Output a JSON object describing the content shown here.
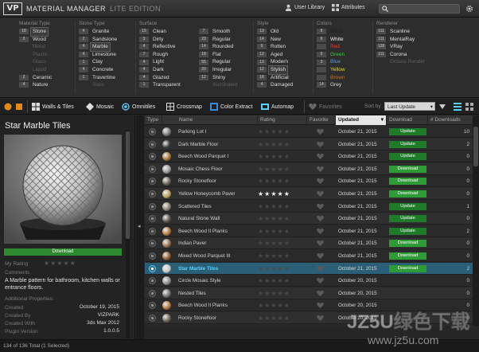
{
  "title_bar": {
    "logo": "VP",
    "app_title": "MATERIAL MANAGER",
    "edition": "LITE EDITION",
    "user_library": "User Library",
    "attributes": "Attributes",
    "search_placeholder": ""
  },
  "filters": {
    "material_type": {
      "header": "Material Type",
      "items": [
        {
          "count": "18",
          "label": "Stone",
          "selected": true
        },
        {
          "count": "3",
          "label": "Wood",
          "selected": false
        },
        {
          "count": "",
          "label": "Metal",
          "dim": true
        },
        {
          "count": "",
          "label": "Plastic",
          "dim": true
        },
        {
          "count": "",
          "label": "Glass",
          "dim": true
        },
        {
          "count": "",
          "label": "Liquid",
          "dim": true
        },
        {
          "count": "2",
          "label": "Ceramic",
          "selected": false
        },
        {
          "count": "4",
          "label": "Nature",
          "selected": false
        }
      ]
    },
    "stone_type": {
      "header": "Stone Type",
      "items": [
        {
          "count": "4",
          "label": "Granite",
          "selected": false
        },
        {
          "count": "2",
          "label": "Sandstone",
          "selected": false
        },
        {
          "count": "4",
          "label": "Marble",
          "selected": true
        },
        {
          "count": "4",
          "label": "Limestone",
          "selected": false
        },
        {
          "count": "1",
          "label": "Clay",
          "selected": false
        },
        {
          "count": "4",
          "label": "Concrete",
          "selected": false
        },
        {
          "count": "1",
          "label": "Travertine",
          "selected": false
        },
        {
          "count": "",
          "label": "Slate",
          "dim": true
        }
      ]
    },
    "surface_1": {
      "header": "Surface",
      "items": [
        {
          "count": "15",
          "label": "Clean",
          "selected": false
        },
        {
          "count": "3",
          "label": "Dirty",
          "selected": false
        },
        {
          "count": "4",
          "label": "Reflective",
          "selected": false
        },
        {
          "count": "7",
          "label": "Rough",
          "selected": false
        },
        {
          "count": "4",
          "label": "Light",
          "selected": false
        },
        {
          "count": "4",
          "label": "Dark",
          "selected": false
        },
        {
          "count": "4",
          "label": "Glazed",
          "selected": false
        },
        {
          "count": "1",
          "label": "Transparent",
          "selected": false
        }
      ]
    },
    "surface_2": {
      "items": [
        {
          "count": "7",
          "label": "Smooth",
          "selected": false
        },
        {
          "count": "23",
          "label": "Regular",
          "selected": false
        },
        {
          "count": "14",
          "label": "Rounded",
          "selected": false
        },
        {
          "count": "18",
          "label": "Flat",
          "selected": false
        },
        {
          "count": "55",
          "label": "Regular",
          "selected": false
        },
        {
          "count": "20",
          "label": "Irregular",
          "selected": false
        },
        {
          "count": "12",
          "label": "Shiny",
          "selected": false
        },
        {
          "count": "",
          "label": "Illuminated",
          "dim": true
        }
      ]
    },
    "style": {
      "header": "Style",
      "items": [
        {
          "count": "13",
          "label": "Old",
          "selected": false
        },
        {
          "count": "14",
          "label": "New",
          "selected": false
        },
        {
          "count": "9",
          "label": "Rotten",
          "selected": false
        },
        {
          "count": "12",
          "label": "Aged",
          "selected": false
        },
        {
          "count": "13",
          "label": "Modern",
          "selected": false
        },
        {
          "count": "12",
          "label": "Stylish",
          "selected": true
        },
        {
          "count": "18",
          "label": "Artificial",
          "selected": false
        },
        {
          "count": "4",
          "label": "Damaged",
          "selected": false
        }
      ]
    },
    "colors": {
      "header": "Colors",
      "items": [
        {
          "count": "8",
          "label": "Black",
          "color": "#222222"
        },
        {
          "count": "6",
          "label": "White",
          "color": "#f0f0f0"
        },
        {
          "count": "",
          "label": "Red",
          "color": "#e03a2a"
        },
        {
          "count": "6",
          "label": "Green",
          "color": "#3cc44a"
        },
        {
          "count": "3",
          "label": "Blue",
          "color": "#4aa0e8"
        },
        {
          "count": "",
          "label": "Yellow",
          "color": "#e8d23a"
        },
        {
          "count": "",
          "label": "Brown",
          "color": "#b87430"
        },
        {
          "count": "14",
          "label": "Grey",
          "color": "#dddddd"
        }
      ]
    },
    "renderer": {
      "header": "Renderer",
      "items": [
        {
          "count": "111",
          "label": "Scanline",
          "selected": false
        },
        {
          "count": "111",
          "label": "MentalRay",
          "selected": false
        },
        {
          "count": "128",
          "label": "VRay",
          "selected": false
        },
        {
          "count": "111",
          "label": "Corona",
          "selected": false
        },
        {
          "count": "",
          "label": "Octane Render",
          "dim": true
        }
      ]
    }
  },
  "toolbar": {
    "walls_tiles": "Walls & Tiles",
    "mosaic": "Mosaic",
    "omnitiles": "Omnitiles",
    "crossmap": "Crossmap",
    "color_extract": "Color Extract",
    "automap": "Automap",
    "favorites": "Favorites",
    "sort_by_label": "Sort by",
    "sort_by_value": "Last Update"
  },
  "preview": {
    "title": "Star Marble Tiles",
    "download_label": "Download",
    "my_rating_label": "My Rating",
    "comments_label": "Comments",
    "description": "A Marble pattern for bathroom, kitchen walls or entrance floors.",
    "additional_properties_label": "Additional Properties:",
    "created_label": "Created",
    "created_value": "October 19, 2015",
    "created_by_label": "Created By",
    "created_by_value": "VIZPARK",
    "created_with_label": "Created With",
    "created_with_value": "3ds Max 2012",
    "plugin_version_label": "Plugin Version",
    "plugin_version_value": "1.0.0.5"
  },
  "list": {
    "columns": {
      "type": "Type",
      "name": "Name",
      "rating": "Rating",
      "favorite": "Favorite",
      "updated": "Updated",
      "download": "Download",
      "downloads": "# Downloads"
    },
    "rows": [
      {
        "name": "Parking Lot I",
        "rating": 0,
        "updated": "October 21, 2015",
        "action": "Update",
        "downloads": "10",
        "thumb": "#7a7a7a"
      },
      {
        "name": "Dark Marble Floor",
        "rating": 0,
        "updated": "October 21, 2015",
        "action": "Update",
        "downloads": "2",
        "thumb": "#3a3a3a"
      },
      {
        "name": "Beech Wood Parquet I",
        "rating": 0,
        "updated": "October 21, 2015",
        "action": "Update",
        "downloads": "0",
        "thumb": "#a8743a"
      },
      {
        "name": "Mosaic Chess Floor",
        "rating": 0,
        "updated": "October 21, 2015",
        "action": "Download",
        "downloads": "0",
        "thumb": "#9a9a9a"
      },
      {
        "name": "Rocky Stonefloor",
        "rating": 0,
        "updated": "October 21, 2015",
        "action": "Download",
        "downloads": "0",
        "thumb": "#6c6256"
      },
      {
        "name": "Yellow Honeycomb Paver",
        "rating": 5,
        "updated": "October 21, 2015",
        "action": "Download",
        "downloads": "0",
        "thumb": "#b8a060"
      },
      {
        "name": "Scattered Tiles",
        "rating": 0,
        "updated": "October 21, 2015",
        "action": "Update",
        "downloads": "1",
        "thumb": "#8a8070"
      },
      {
        "name": "Natural Stone Wall",
        "rating": 0,
        "updated": "October 21, 2015",
        "action": "Update",
        "downloads": "0",
        "thumb": "#5a544c"
      },
      {
        "name": "Beech Wood II Planks",
        "rating": 0,
        "updated": "October 21, 2015",
        "action": "Update",
        "downloads": "2",
        "thumb": "#b07840"
      },
      {
        "name": "Indian Paver",
        "rating": 0,
        "updated": "October 21, 2015",
        "action": "Download",
        "downloads": "0",
        "thumb": "#9a7050"
      },
      {
        "name": "Mixed Wood Parquet III",
        "rating": 0,
        "updated": "October 21, 2015",
        "action": "Download",
        "downloads": "0",
        "thumb": "#8a5a30"
      },
      {
        "name": "Star Marble Tiles",
        "rating": 0,
        "updated": "October 21, 2015",
        "action": "Download",
        "downloads": "2",
        "thumb": "#c8c8c8",
        "selected": true
      },
      {
        "name": "Circle Mosaic Style",
        "rating": 0,
        "updated": "October 20, 2015",
        "action": "",
        "downloads": "0",
        "thumb": "#8c8c8c"
      },
      {
        "name": "Nested Tiles",
        "rating": 0,
        "updated": "October 20, 2015",
        "action": "",
        "downloads": "0",
        "thumb": "#707070"
      },
      {
        "name": "Beech Wood II Planks",
        "rating": 0,
        "updated": "October 20, 2015",
        "action": "",
        "downloads": "0",
        "thumb": "#b07840"
      },
      {
        "name": "Rocky Stonefloor",
        "rating": 0,
        "updated": "October 20, 2015",
        "action": "",
        "downloads": "0",
        "thumb": "#6c6256"
      }
    ]
  },
  "status": {
    "text": "134 of 136 Total (1 Selected)"
  },
  "watermark": {
    "text": "JZ5U绿色下载",
    "url": "www.jz5u.com"
  },
  "colors": {
    "accent_blue": "#2b5f78",
    "selected_text": "#5ad0ff",
    "download_green": "#2e9c34",
    "update_green": "#1f7a2a"
  }
}
